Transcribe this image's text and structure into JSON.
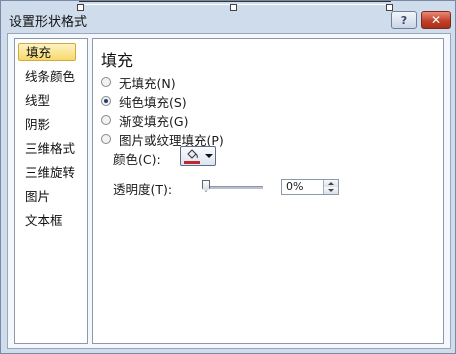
{
  "window": {
    "title": "设置形状格式",
    "help_label": "?",
    "close_label": "✕"
  },
  "sidebar": {
    "items": [
      {
        "label": "填充",
        "active": true
      },
      {
        "label": "线条颜色"
      },
      {
        "label": "线型"
      },
      {
        "label": "阴影"
      },
      {
        "label": "三维格式"
      },
      {
        "label": "三维旋转"
      },
      {
        "label": "图片"
      },
      {
        "label": "文本框"
      }
    ]
  },
  "fill": {
    "heading": "填充",
    "options": [
      {
        "label": "无填充(N)",
        "checked": false
      },
      {
        "label": "纯色填充(S)",
        "checked": true
      },
      {
        "label": "渐变填充(G)",
        "checked": false
      },
      {
        "label": "图片或纹理填充(P)",
        "checked": false
      }
    ],
    "color_label": "颜色(C):",
    "color_value": "#c0282d",
    "transparency_label": "透明度(T):",
    "transparency_value": "0%",
    "transparency_fraction": 0
  },
  "icons": {
    "bucket": "paint-bucket-icon",
    "dropdown": "chevron-down-icon",
    "spin_up": "spin-up-icon",
    "spin_down": "spin-down-icon"
  }
}
